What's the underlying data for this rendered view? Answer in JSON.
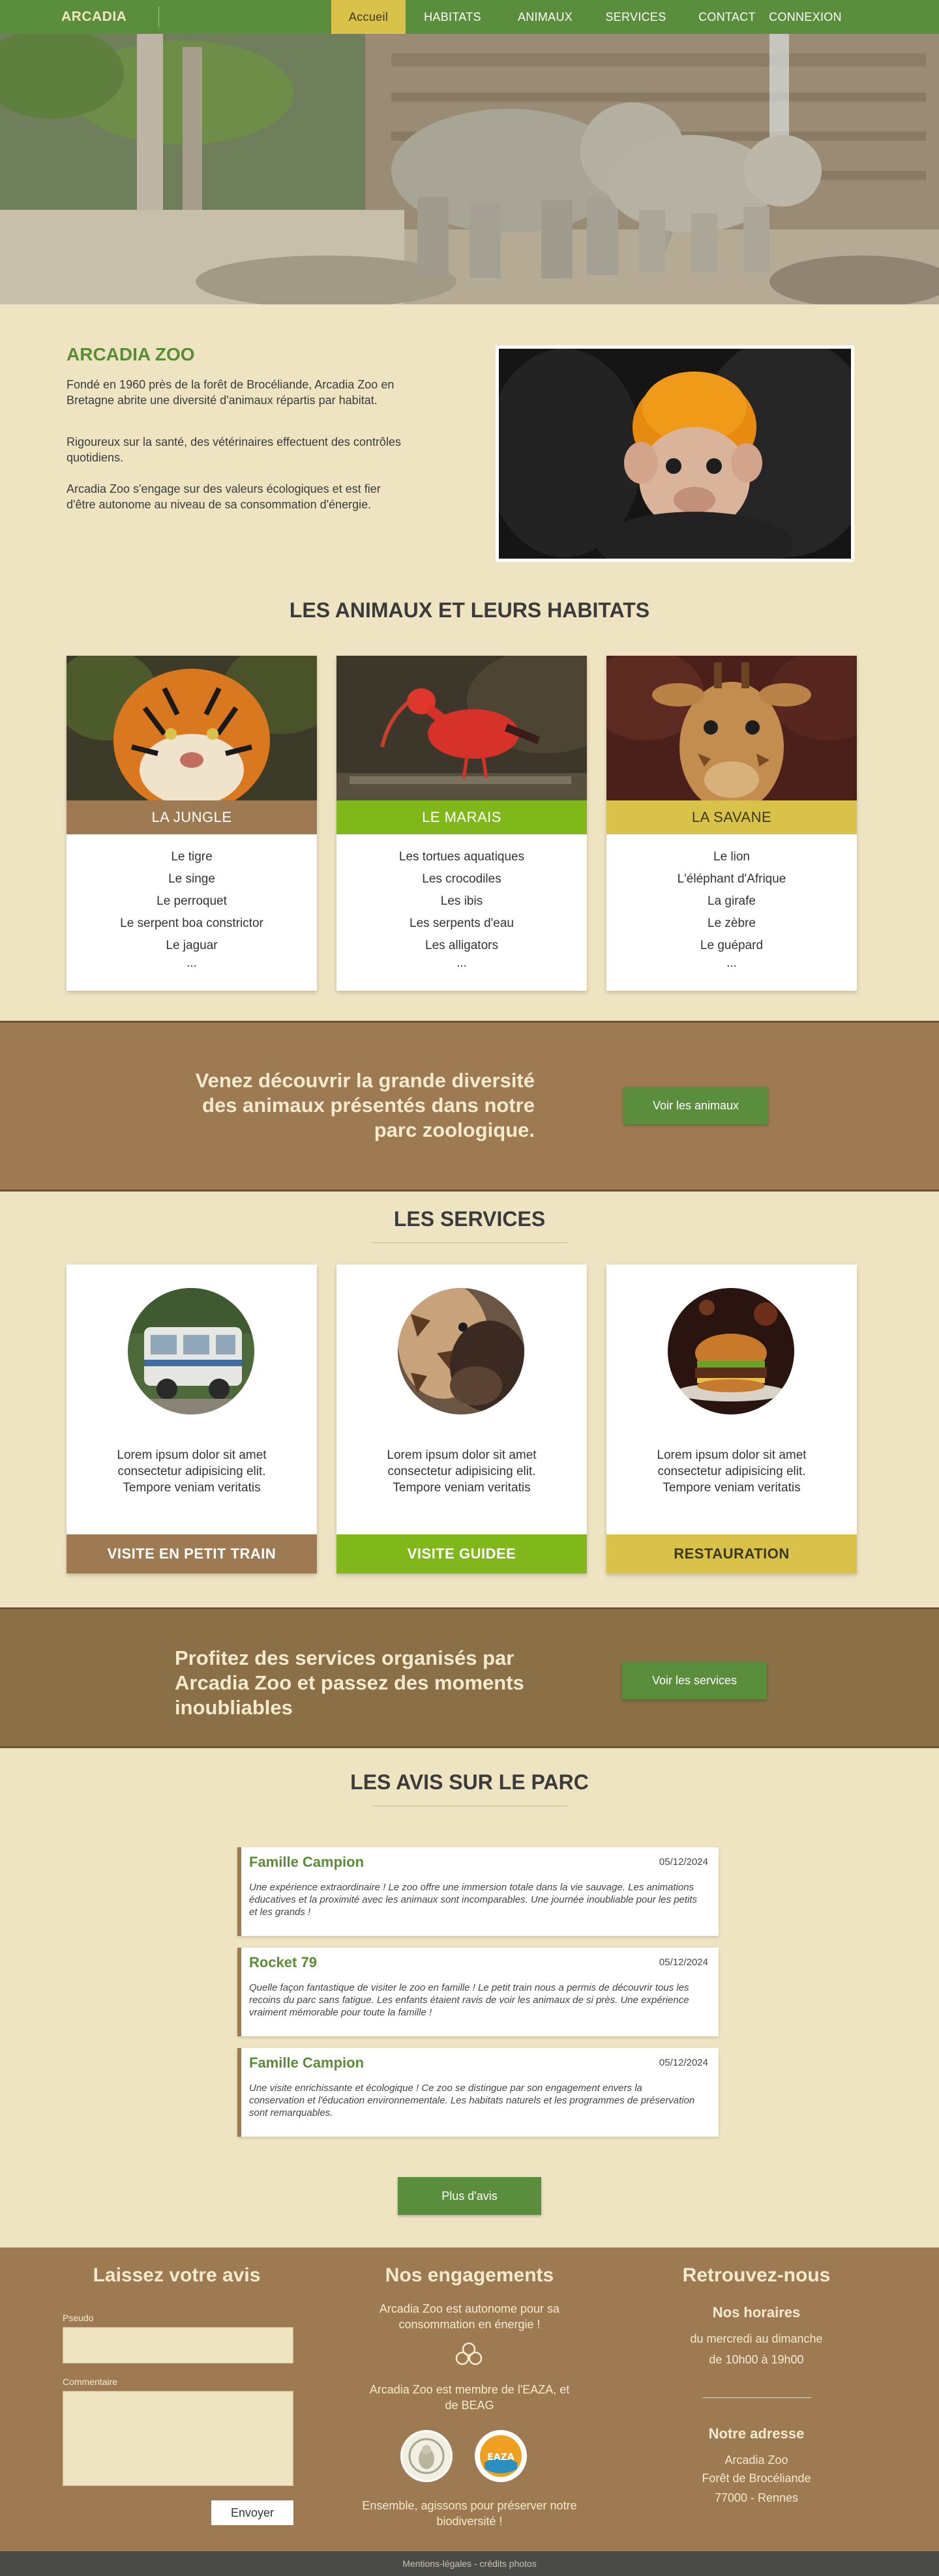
{
  "nav": {
    "brand": "ARCADIA",
    "links": [
      "Accueil",
      "HABITATS",
      "ANIMAUX",
      "SERVICES",
      "CONTACT",
      "CONNEXION"
    ]
  },
  "about": {
    "title": "ARCADIA ZOO",
    "p1": "Fondé en 1960 près de la forêt de Brocéliande, Arcadia Zoo en Bretagne abrite une diversité d'animaux répartis par habitat.",
    "p2": "Rigoureux sur la santé, des vétérinaires effectuent des contrôles quotidiens.",
    "p3": "Arcadia Zoo s'engage sur des valeurs écologiques et est fier d'être autonome au niveau de sa consommation d'énergie."
  },
  "habitats": {
    "title": "LES ANIMAUX ET LEURS HABITATS",
    "cards": [
      {
        "name": "LA JUNGLE",
        "animals": [
          "Le tigre",
          "Le singe",
          "Le perroquet",
          "Le serpent boa constrictor",
          "Le jaguar",
          "..."
        ]
      },
      {
        "name": "LE MARAIS",
        "animals": [
          "Les tortues aquatiques",
          "Les crocodiles",
          "Les ibis",
          "Les serpents d'eau",
          "Les alligators",
          "..."
        ]
      },
      {
        "name": "LA SAVANE",
        "animals": [
          "Le lion",
          "L'éléphant d'Afrique",
          "La girafe",
          "Le zèbre",
          "Le guépard",
          "..."
        ]
      }
    ]
  },
  "banner1": {
    "text": "Venez découvrir la grande diversité des animaux présentés dans notre parc zoologique.",
    "button": "Voir les animaux"
  },
  "services": {
    "title": "LES SERVICES",
    "cards": [
      {
        "text": "Lorem ipsum dolor sit amet consectetur adipisicing elit. Tempore veniam veritatis",
        "name": "VISITE EN PETIT TRAIN"
      },
      {
        "text": "Lorem ipsum dolor sit amet consectetur adipisicing elit. Tempore veniam veritatis",
        "name": "VISITE GUIDEE"
      },
      {
        "text": "Lorem ipsum dolor sit amet consectetur adipisicing elit. Tempore veniam veritatis",
        "name": "RESTAURATION"
      }
    ]
  },
  "banner2": {
    "text": "Profitez des services organisés par Arcadia Zoo et passez des moments inoubliables",
    "button": "Voir les services"
  },
  "reviews": {
    "title": "LES AVIS SUR LE PARC",
    "items": [
      {
        "name": "Famille Campion",
        "date": "05/12/2024",
        "text": "Une expérience extraordinaire ! Le zoo offre une immersion totale dans la vie sauvage. Les animations éducatives et la proximité avec les animaux sont incomparables. Une journée inoubliable pour les petits et les grands !"
      },
      {
        "name": "Rocket 79",
        "date": "05/12/2024",
        "text": "Quelle façon fantastique de visiter le zoo en famille ! Le petit train nous a permis de découvrir tous les recoins du parc sans fatigue. Les enfants étaient ravis de voir les animaux de si près. Une expérience vraiment mémorable pour toute la famille !"
      },
      {
        "name": "Famille Campion",
        "date": "05/12/2024",
        "text": "Une visite enrichissante et écologique ! Ce zoo se distingue par son engagement envers la conservation et l'éducation environnementale. Les habitats naturels et les programmes de préservation sont remarquables."
      }
    ],
    "more_button": "Plus d'avis"
  },
  "footer": {
    "review_form": {
      "title": "Laissez votre avis",
      "pseudo_label": "Pseudo",
      "comment_label": "Commentaire",
      "submit": "Envoyer"
    },
    "engagements": {
      "title": "Nos engagements",
      "text1": "Arcadia Zoo est autonome pour sa consommation en énergie !",
      "text2": "Arcadia Zoo est membre de l'EAZA, et de BEAG",
      "text3": "Ensemble, agissons pour préserver notre biodiversité !",
      "logo1": "BEAG",
      "logo2": "EAZA"
    },
    "contact": {
      "title": "Retrouvez-nous",
      "hours_title": "Nos horaires",
      "hours_days": "du mercredi au dimanche",
      "hours_time": "de 10h00 à 19h00",
      "address_title": "Notre adresse",
      "address1": "Arcadia Zoo",
      "address2": "Forêt de Brocéliande",
      "address3": "77000 - Rennes"
    },
    "bottom": "Mentions-légales - crédits photos"
  },
  "colors": {
    "green": "#5b8e3c",
    "yellow": "#d8c24a",
    "brown": "#9e7a52",
    "cream": "#efe4c2",
    "lime": "#80b81b"
  }
}
